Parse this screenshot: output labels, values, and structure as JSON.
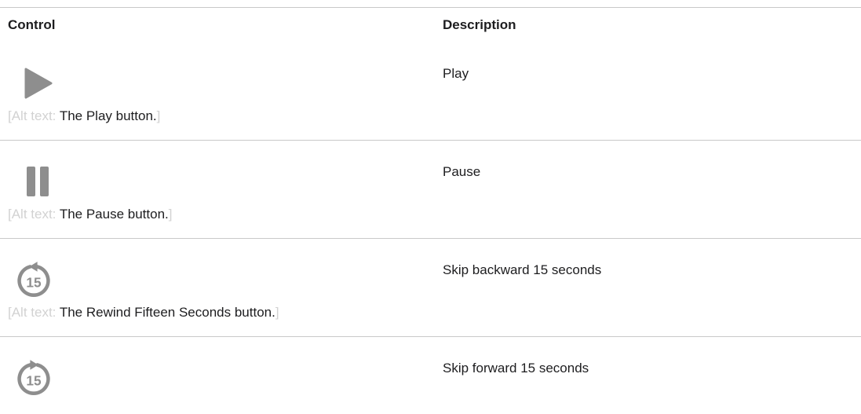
{
  "table": {
    "headers": {
      "control": "Control",
      "description": "Description"
    },
    "alt_prefix": "[Alt text: ",
    "alt_suffix": "]",
    "rows": [
      {
        "icon": "play-icon",
        "alt_text": "The Play button.",
        "description": "Play"
      },
      {
        "icon": "pause-icon",
        "alt_text": "The Pause button.",
        "description": "Pause"
      },
      {
        "icon": "rewind-15-icon",
        "icon_label": "15",
        "alt_text": "The Rewind Fifteen Seconds button.",
        "description": "Skip backward 15 seconds"
      },
      {
        "icon": "forward-15-icon",
        "icon_label": "15",
        "description": "Skip forward 15 seconds"
      }
    ]
  },
  "colors": {
    "icon": "#8e8e8e",
    "rule": "#c9c9c9",
    "muted": "#d2d2d2",
    "text": "#1d1d1f"
  }
}
